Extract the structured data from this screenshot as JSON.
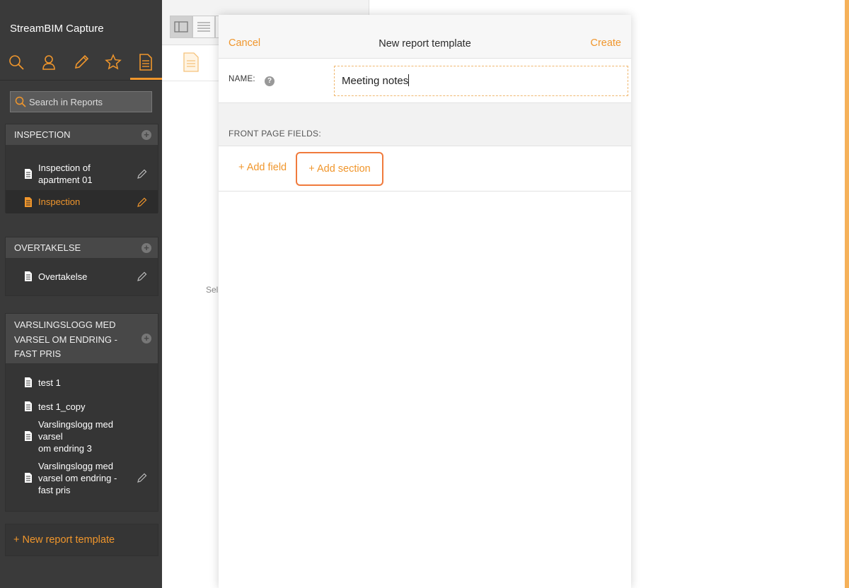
{
  "app": {
    "title": "StreamBIM Capture"
  },
  "nav": {
    "icons": [
      "search-icon",
      "user-icon",
      "pencil-icon",
      "star-icon",
      "report-icon"
    ],
    "active": "report-icon"
  },
  "search": {
    "placeholder": "Search in Reports"
  },
  "groups": [
    {
      "title": "INSPECTION",
      "items": [
        {
          "label_line1": "Inspection of",
          "label_line2": "apartment 01",
          "active": false
        },
        {
          "label_line1": "Inspection",
          "label_line2": "",
          "active": true
        }
      ]
    },
    {
      "title": "OVERTAKELSE",
      "items": [
        {
          "label_line1": "Overtakelse",
          "label_line2": "",
          "active": false
        }
      ]
    },
    {
      "title_line1": "VARSLINGSLOGG MED",
      "title_line2": "VARSEL OM ENDRING -",
      "title_line3": "FAST PRIS",
      "items": [
        {
          "label_line1": "test 1"
        },
        {
          "label_line1": "test 1_copy"
        },
        {
          "label_line1": "Varslingslogg med varsel",
          "label_line2": "om endring 3"
        },
        {
          "label_line1": "Varslingslogg med",
          "label_line2": "varsel om endring -",
          "label_line3": "fast pris"
        }
      ]
    }
  ],
  "new_template_label": "+ New report template",
  "middle": {
    "hint": "Sel"
  },
  "modal": {
    "cancel": "Cancel",
    "title": "New report template",
    "create": "Create",
    "name_label": "NAME:",
    "help": "?",
    "name_value": "Meeting notes",
    "front_page_label": "FRONT PAGE FIELDS:",
    "add_field": "+ Add field",
    "add_section": "+ Add section"
  },
  "colors": {
    "accent": "#f0962c",
    "sidebar": "#3a3a3a",
    "highlight": "#f07a3c"
  }
}
